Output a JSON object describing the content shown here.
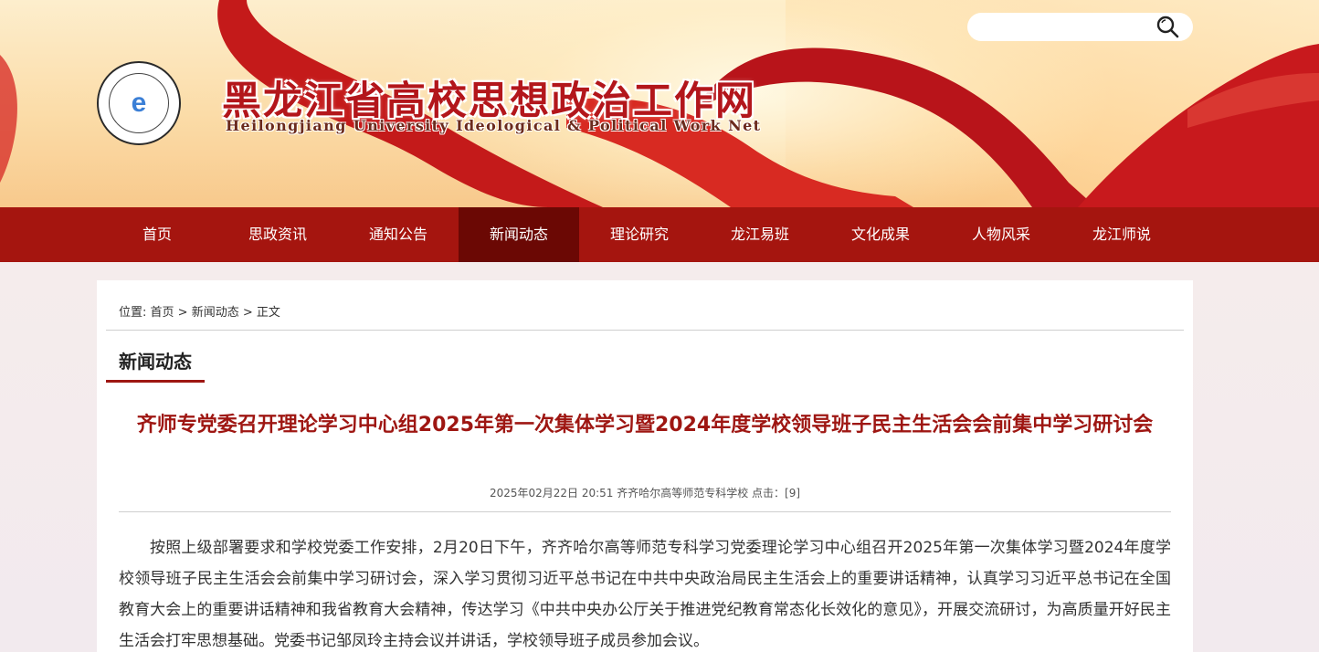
{
  "header": {
    "site_title": "黑龙江省高校思想政治工作网",
    "site_subtitle": "Heilongjiang University Ideological & Political Work Net",
    "logo_letter": "e",
    "search": {
      "placeholder": "",
      "value": ""
    }
  },
  "nav": {
    "items": [
      {
        "label": "首页"
      },
      {
        "label": "思政资讯"
      },
      {
        "label": "通知公告"
      },
      {
        "label": "新闻动态",
        "active": true
      },
      {
        "label": "理论研究"
      },
      {
        "label": "龙江易班"
      },
      {
        "label": "文化成果"
      },
      {
        "label": "人物风采"
      },
      {
        "label": "龙江师说"
      }
    ]
  },
  "breadcrumb": {
    "prefix": "位置: ",
    "home": "首页",
    "sep1": " > ",
    "section": "新闻动态",
    "sep2": " > ",
    "current": "正文"
  },
  "section_title": "新闻动态",
  "article": {
    "title": "齐师专党委召开理论学习中心组2025年第一次集体学习暨2024年度学校领导班子民主生活会会前集中学习研讨会",
    "meta": "2025年02月22日 20:51 齐齐哈尔高等师范专科学校 点击：[9]",
    "body": "按照上级部署要求和学校党委工作安排，2月20日下午，齐齐哈尔高等师范专科学习党委理论学习中心组召开2025年第一次集体学习暨2024年度学校领导班子民主生活会会前集中学习研讨会，深入学习贯彻习近平总书记在中共中央政治局民主生活会上的重要讲话精神，认真学习习近平总书记在全国教育大会上的重要讲话精神和我省教育大会精神，传达学习《中共中央办公厅关于推进党纪教育常态化长效化的意见》，开展交流研讨，为高质量开好民主生活会打牢思想基础。党委书记邹凤玲主持会议并讲话，学校领导班子成员参加会议。"
  },
  "colors": {
    "nav_bg": "#a5150f",
    "nav_active": "#6b0804",
    "title_red": "#9e1612"
  }
}
